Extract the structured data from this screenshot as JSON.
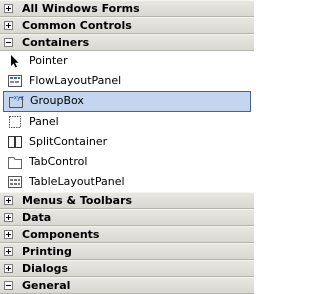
{
  "categories_top": [
    {
      "label": "All Windows Forms",
      "state": "collapsed"
    },
    {
      "label": "Common Controls",
      "state": "collapsed"
    },
    {
      "label": "Containers",
      "state": "expanded"
    }
  ],
  "container_items": [
    {
      "label": "Pointer",
      "icon": "pointer-icon"
    },
    {
      "label": "FlowLayoutPanel",
      "icon": "flowlayoutpanel-icon"
    },
    {
      "label": "GroupBox",
      "icon": "groupbox-icon",
      "selected": true
    },
    {
      "label": "Panel",
      "icon": "panel-icon"
    },
    {
      "label": "SplitContainer",
      "icon": "splitcontainer-icon"
    },
    {
      "label": "TabControl",
      "icon": "tabcontrol-icon"
    },
    {
      "label": "TableLayoutPanel",
      "icon": "tablelayoutpanel-icon"
    }
  ],
  "categories_bottom": [
    {
      "label": "Menus & Toolbars",
      "state": "collapsed"
    },
    {
      "label": "Data",
      "state": "collapsed"
    },
    {
      "label": "Components",
      "state": "collapsed"
    },
    {
      "label": "Printing",
      "state": "collapsed"
    },
    {
      "label": "Dialogs",
      "state": "collapsed"
    },
    {
      "label": "General",
      "state": "expanded"
    }
  ],
  "colors": {
    "selection_fill": "#c4d6ef",
    "selection_border": "#3f63a8",
    "header_fill": "#dedcd5"
  }
}
